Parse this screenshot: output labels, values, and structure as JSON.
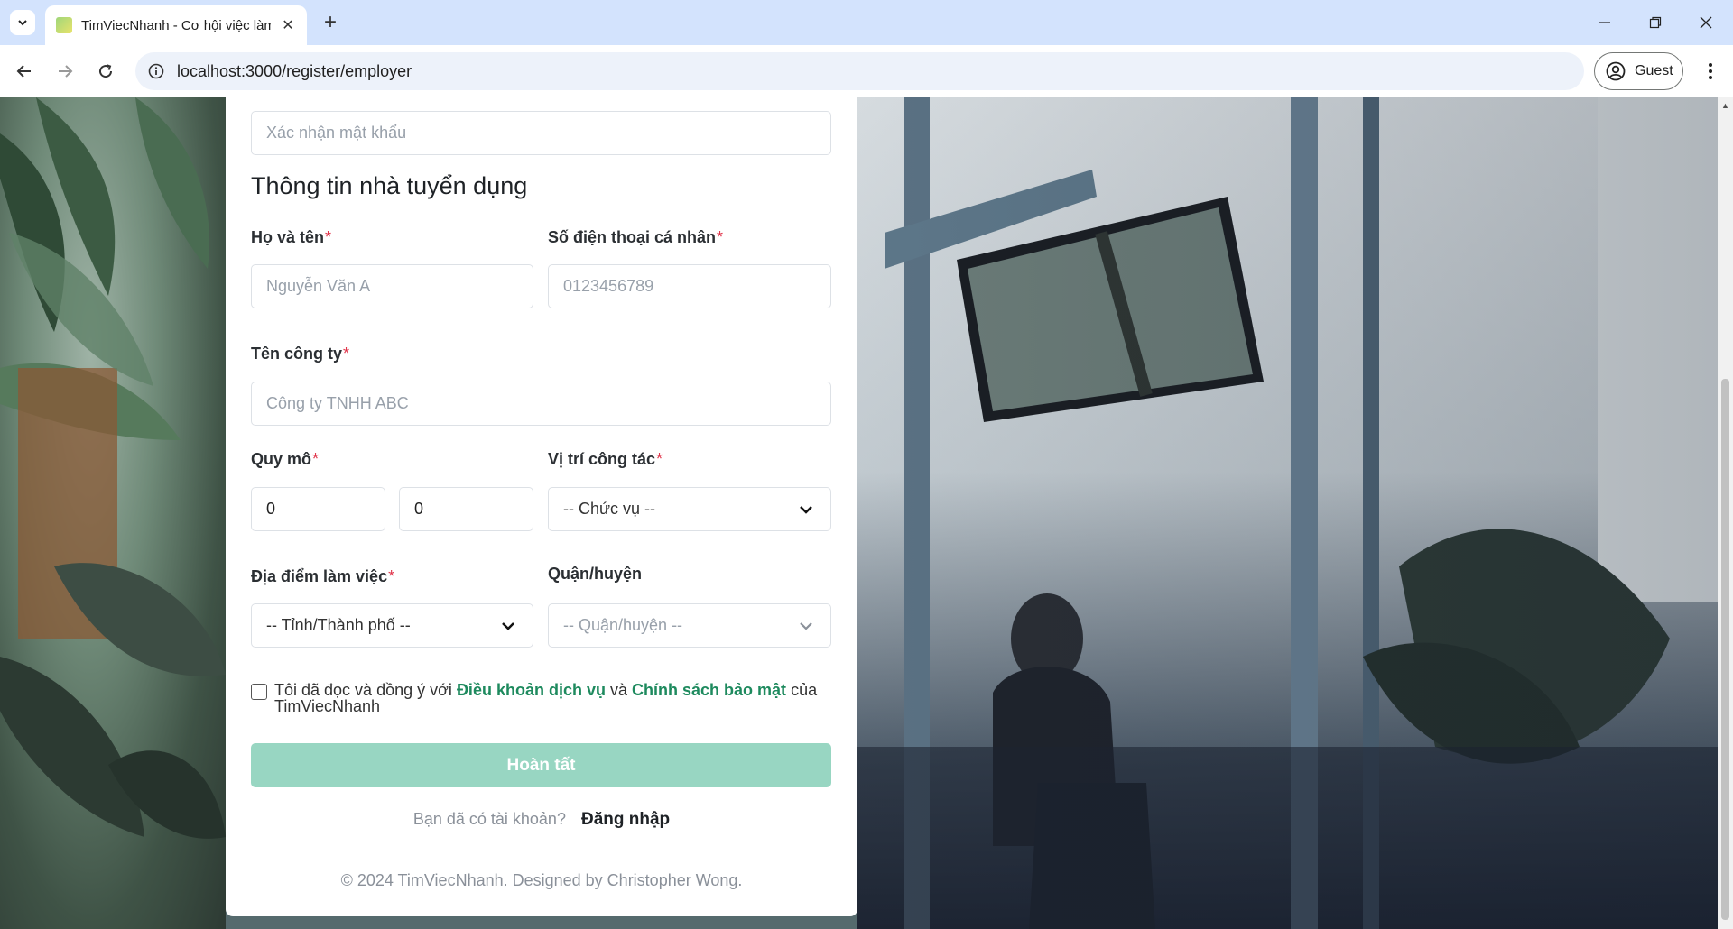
{
  "browser": {
    "tab_title": "TimViecNhanh - Cơ hội việc làm",
    "url": "localhost:3000/register/employer",
    "profile_label": "Guest"
  },
  "form": {
    "confirm_password_placeholder": "Xác nhận mật khẩu",
    "section_title": "Thông tin nhà tuyển dụng",
    "fullname_label": "Họ và tên",
    "fullname_placeholder": "Nguyễn Văn A",
    "phone_label": "Số điện thoại cá nhân",
    "phone_placeholder": "0123456789",
    "company_label": "Tên công ty",
    "company_placeholder": "Công ty TNHH ABC",
    "scale_label": "Quy mô",
    "scale_min_value": "0",
    "scale_max_value": "0",
    "position_label": "Vị trí công tác",
    "position_select": "-- Chức vụ --",
    "location_label": "Địa điểm làm việc",
    "province_select": "-- Tỉnh/Thành phố --",
    "district_label": "Quận/huyện",
    "district_select": "-- Quận/huyện --",
    "required_mark": "*",
    "agree_prefix": "Tôi đã đọc và đồng ý với",
    "terms_link": "Điều khoản dịch vụ",
    "agree_and": "và",
    "privacy_link": "Chính sách bảo mật",
    "agree_suffix": "của TimViecNhanh",
    "submit_label": "Hoàn tất",
    "have_account_text": "Bạn đã có tài khoản?",
    "login_link": "Đăng nhập",
    "footer_text": "© 2024 TimViecNhanh. Designed by Christopher Wong."
  },
  "colors": {
    "accent_green": "#1e8a5e",
    "submit_disabled": "#98d6c2",
    "required_red": "#e0344a"
  }
}
